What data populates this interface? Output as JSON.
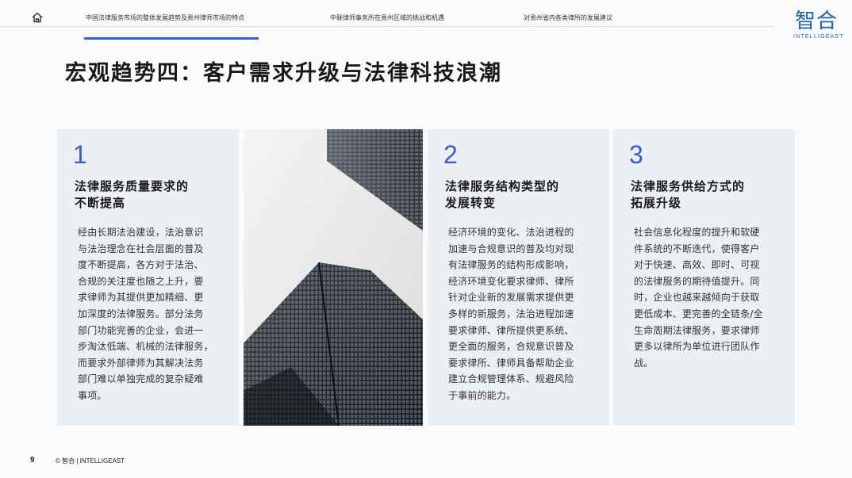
{
  "nav": {
    "tabs": [
      {
        "label": "中国法律服务市场的整体发展趋势及贵州律师市场的特点"
      },
      {
        "label": "中联律师事务所在贵州区域的挑战和机遇"
      },
      {
        "label": "对贵州省内各类律所的发展建议"
      }
    ],
    "active_index": 0,
    "accent_color": "#3a5bd9"
  },
  "logo": {
    "cn": "智合",
    "en": "INTELLIGEAST",
    "color": "#1e5fb0"
  },
  "page_title": "宏观趋势四：客户需求升级与法律科技浪潮",
  "cards": [
    {
      "number": "1",
      "heading_lines": [
        "法律服务质量要求的",
        "不断提高"
      ],
      "body_lines": [
        "经由长期法治建设，法治意识",
        "与法治理念在社会层面的普及",
        "度不断提高，各方对于法治、",
        "合规的关注度也随之上升，要",
        "求律师为其提供更加精细、更",
        "加深度的法律服务。部分法务",
        "部门功能完善的企业，会进一",
        "步淘汰低端、机械的法律服务，",
        "而要求外部律师为其解决法务",
        "部门难以单独完成的复杂疑难",
        "事项。"
      ]
    },
    {
      "number": "2",
      "heading_lines": [
        "法律服务结构类型的",
        "发展转变"
      ],
      "body_lines": [
        "经济环境的变化、法治进程的",
        "加速与合规意识的普及均对现",
        "有法律服务的结构形成影响，",
        "经济环境变化要求律师、律所",
        "针对企业新的发展需求提供更",
        "多样的新服务，法治进程加速",
        "要求律师、律所提供更系统、",
        "更全面的服务，合规意识普及",
        "要求律所、律师具备帮助企业",
        "建立合规管理体系、规避风险",
        "于事前的能力。"
      ]
    },
    {
      "number": "3",
      "heading_lines": [
        "法律服务供给方式的",
        "拓展升级"
      ],
      "body_lines": [
        "社会信息化程度的提升和软硬",
        "件系统的不断迭代，使得客户",
        "对于快速、高效、即时、可视",
        "的法律服务的期待值提升。同",
        "时，企业也越来越倾向于获取",
        "更低成本、更完善的全链条/全",
        "生命周期法律服务，要求律师",
        "更多以律所为单位进行团队作",
        "战。"
      ]
    }
  ],
  "footer": {
    "page_number": "9",
    "copyright": "© 智合 | INTELLIGEAST"
  }
}
